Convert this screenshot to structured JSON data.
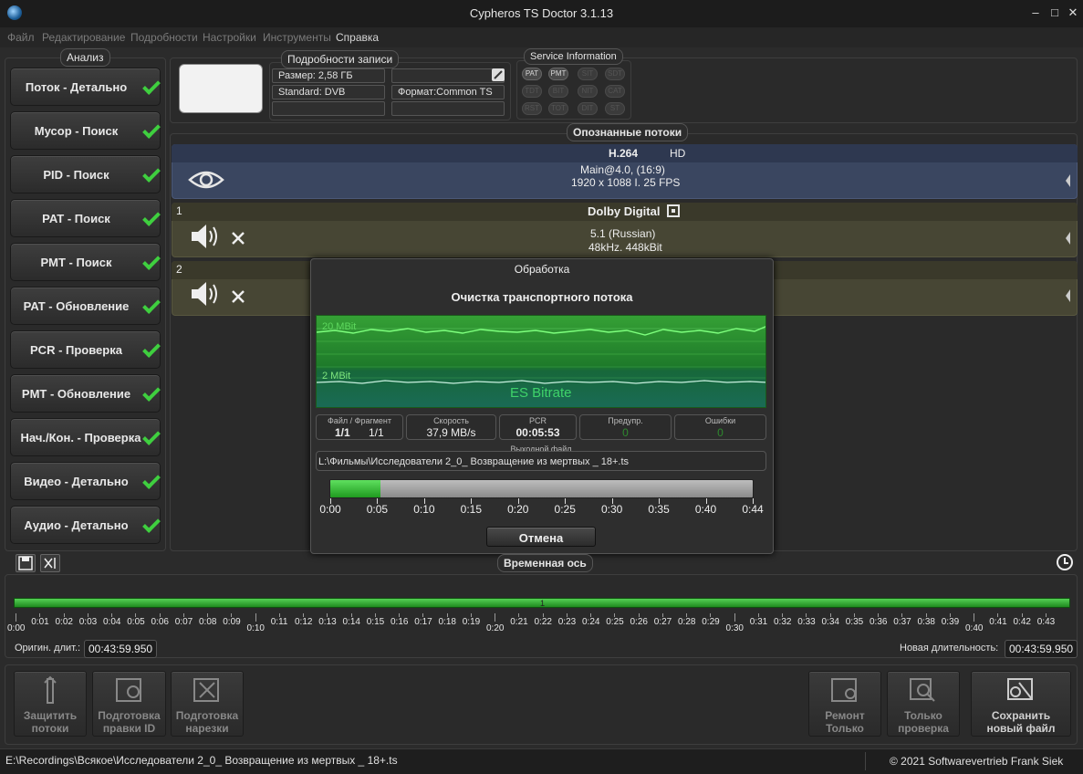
{
  "window": {
    "title": "Cypheros TS Doctor 3.1.13",
    "min_glyph": "–",
    "max_glyph": "□",
    "close_glyph": "✕"
  },
  "menu": [
    "Файл",
    "Редактирование",
    "Подробности",
    "Настройки",
    "Инструменты",
    "Справка"
  ],
  "analysis": {
    "title": "Анализ",
    "items": [
      "Поток - Детально",
      "Мусор - Поиск",
      "PID - Поиск",
      "PAT - Поиск",
      "PMT - Поиск",
      "PAT - Обновление",
      "PCR - Проверка",
      "PMT - Обновление",
      "Нач./Кон. - Проверка",
      "Видео - Детально",
      "Аудио - Детально"
    ]
  },
  "record": {
    "title": "Подробности записи",
    "size": "Размер:  2,58 ГБ",
    "standard": "Standard: DVB",
    "format": "Формат:Common TS"
  },
  "service_info": {
    "title": "Service Information",
    "badges": [
      {
        "label": "PAT",
        "on": true
      },
      {
        "label": "PMT",
        "on": true
      },
      {
        "label": "SIT",
        "on": false
      },
      {
        "label": "SDT",
        "on": false
      },
      {
        "label": "TDT",
        "on": false
      },
      {
        "label": "BIT",
        "on": false
      },
      {
        "label": "NIT",
        "on": false
      },
      {
        "label": "CAT",
        "on": false
      },
      {
        "label": "RST",
        "on": false
      },
      {
        "label": "TOT",
        "on": false
      },
      {
        "label": "DIT",
        "on": false
      },
      {
        "label": "ST",
        "on": false
      }
    ]
  },
  "streams": {
    "title": "Опознанные потоки",
    "video": {
      "codec": "H.264",
      "quality": "HD",
      "profile": "Main@4.0,  (16:9)",
      "resolution": "1920 x 1088 I. 25 FPS"
    },
    "audio1": {
      "number": "1",
      "codec": "Dolby Digital",
      "channels": "5.1 (Russian)",
      "rate": "48kHz. 448kBit"
    },
    "audio2": {
      "number": "2"
    }
  },
  "dialog": {
    "title": "Обработка",
    "subtitle": "Очистка транспортного потока",
    "graph_label_top": "20 MBit",
    "graph_label_low": "2 MBit",
    "graph_label_center": "ES Bitrate",
    "file_fragment_label": "Файл / Фрагмент",
    "file_value": "1/1",
    "fragment_value": "1/1",
    "speed_label": "Скорость",
    "speed_value": "37,9 MB/s",
    "pcr_label": "PCR",
    "pcr_value": "00:05:53",
    "warnings_label": "Предупр.",
    "warnings_value": "0",
    "errors_label": "Ошибки",
    "errors_value": "0",
    "output_label": "Выходной файл",
    "output_path": "L:\\Фильмы\\Исследователи 2_0_ Возвращение из мертвых _ 18+.ts",
    "progress": 0.118,
    "progress_ticks": [
      "0:00",
      "0:05",
      "0:10",
      "0:15",
      "0:20",
      "0:25",
      "0:30",
      "0:35",
      "0:40",
      "0:44"
    ],
    "cancel": "Отмена"
  },
  "timeline": {
    "title": "Временная ось",
    "marker": "1",
    "ticks": [
      "0:00",
      "0:01",
      "0:02",
      "0:03",
      "0:04",
      "0:05",
      "0:06",
      "0:07",
      "0:08",
      "0:09",
      "0:10",
      "0:11",
      "0:12",
      "0:13",
      "0:14",
      "0:15",
      "0:16",
      "0:17",
      "0:18",
      "0:19",
      "0:20",
      "0:21",
      "0:22",
      "0:23",
      "0:24",
      "0:25",
      "0:26",
      "0:27",
      "0:28",
      "0:29",
      "0:30",
      "0:31",
      "0:32",
      "0:33",
      "0:34",
      "0:35",
      "0:36",
      "0:37",
      "0:38",
      "0:39",
      "0:40",
      "0:41",
      "0:42",
      "0:43"
    ],
    "orig_label": "Оригин. длит.:",
    "orig_value": "00:43:59.950",
    "new_label": "Новая длительность:",
    "new_value": "00:43:59.950"
  },
  "bottom_buttons": {
    "protect": [
      "Защитить",
      "потоки"
    ],
    "prep_id": [
      "Подготовка",
      "правки ID"
    ],
    "prep_cut": [
      "Подготовка",
      "нарезки"
    ],
    "repair": [
      "Ремонт",
      "Только"
    ],
    "check_only": [
      "Только",
      "проверка"
    ],
    "save_new": [
      "Сохранить",
      "новый файл"
    ]
  },
  "status": {
    "path": "E:\\Recordings\\Всякое\\Исследователи 2_0_ Возвращение из мертвых _ 18+.ts",
    "copyright": "© 2021 Softwarevertrieb Frank Siek"
  }
}
